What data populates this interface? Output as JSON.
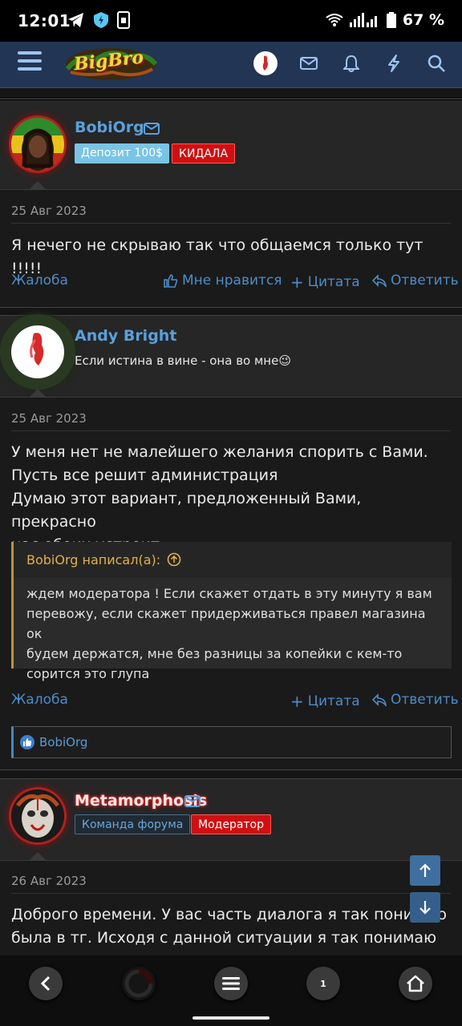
{
  "status_bar": {
    "time": "12:01",
    "battery": "67 %",
    "icons": [
      "telegram-icon",
      "vpn-shield-icon",
      "sim-icon",
      "wifi-icon",
      "signal-icon",
      "battery-icon"
    ]
  },
  "header": {
    "logo_text": "BigBro",
    "icons": [
      "menu-icon",
      "avatar",
      "mail-icon",
      "bell-icon",
      "bolt-icon",
      "search-icon"
    ]
  },
  "posts": [
    {
      "username": "BobiOrg",
      "badges": [
        "Депозит 100$",
        "КИДАЛА"
      ],
      "date": "25 Авг 2023",
      "text": "Я нечего не скрываю так что общаемся только тут !!!!!",
      "actions": {
        "report": "Жалоба",
        "like": "Мне нравится",
        "quote": "Цитата",
        "reply": "Ответить"
      }
    },
    {
      "username": "Andy Bright",
      "status": "Если истина в вине - она во мне😉",
      "date": "25 Авг 2023",
      "text_lines": [
        "У меня нет не малейшего желания спорить с Вами.",
        "Пусть все решит администрация",
        "Думаю этот вариант, предложенный Вами, прекрасно",
        "нас обоих устроит."
      ],
      "quote": {
        "author": "BobiOrg написал(а):",
        "lines": [
          "ждем модератора ! Если скажет отдать в эту минуту я вам",
          "перевожу, если скажет придерживаться правел магазина ок",
          "будем держатся, мне без разницы за копейки с кем-то",
          "сорится это глупа"
        ]
      },
      "actions": {
        "report": "Жалоба",
        "quote": "Цитата",
        "reply": "Ответить"
      },
      "liked_by": "BobiOrg"
    },
    {
      "username": "Metamorphosis",
      "badges": [
        "Команда форума",
        "Модератор"
      ],
      "date": "26 Авг 2023",
      "text_lines": [
        "Доброго времени. У вас часть диалога я так понимаю",
        "была в тг. Исходя с данной ситуации я так понимаю что"
      ]
    }
  ],
  "browser_nav": {
    "tab_count": "1",
    "icons": [
      "back-icon",
      "browser-logo-icon",
      "menu-icon",
      "tabs-icon",
      "home-icon"
    ]
  },
  "colors": {
    "accent": "#5aa0dc",
    "header_bg": "#233554",
    "badge_red": "#d01010",
    "badge_blue": "#7ac4e6",
    "quote_border": "#b8963a"
  }
}
